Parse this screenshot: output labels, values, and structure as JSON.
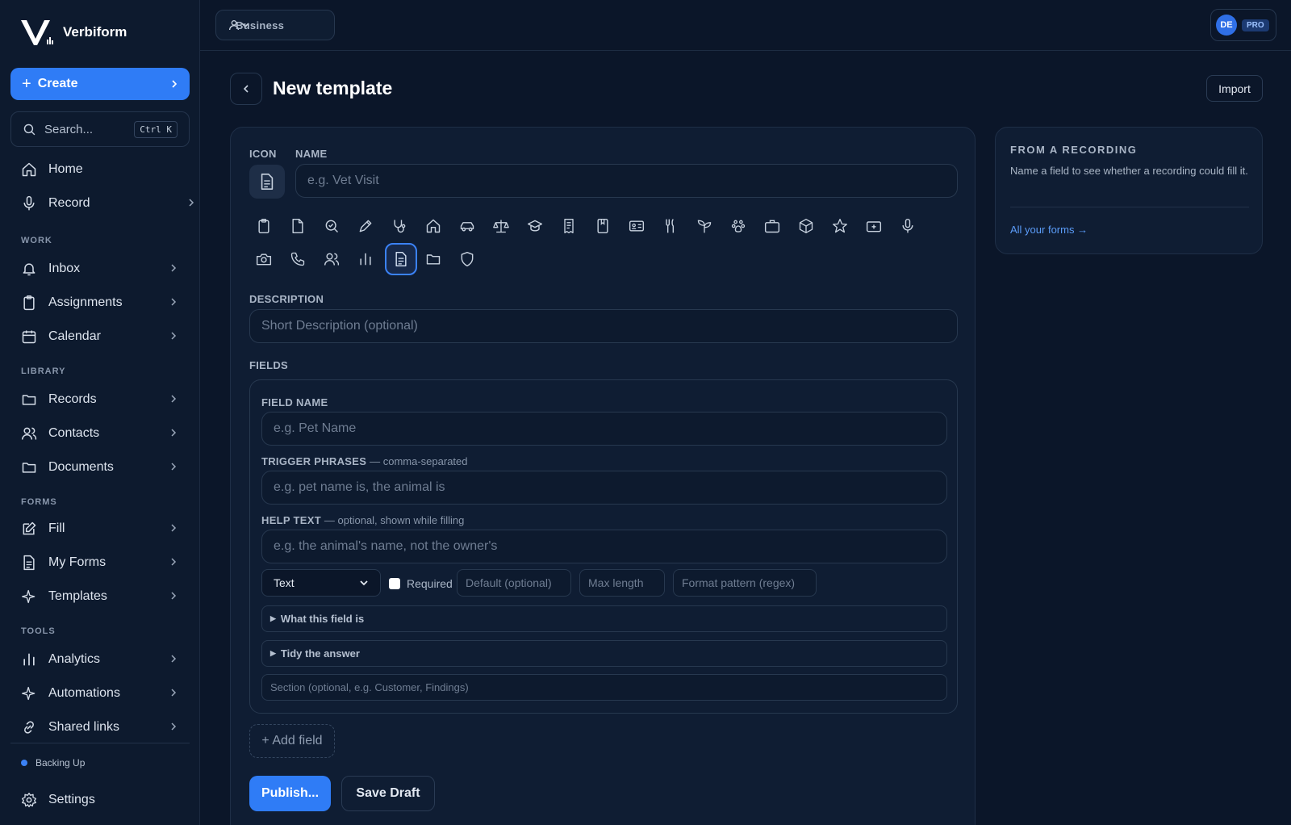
{
  "app": {
    "name": "Verbiform"
  },
  "sidebar": {
    "create_label": "Create",
    "search_placeholder": "Search...",
    "search_shortcut": "Ctrl K",
    "home": "Home",
    "record": "Record",
    "section_work": "WORK",
    "inbox": "Inbox",
    "assignments": "Assignments",
    "calendar": "Calendar",
    "section_library": "LIBRARY",
    "records": "Records",
    "contacts": "Contacts",
    "documents": "Documents",
    "section_forms": "FORMS",
    "fill": "Fill",
    "my_forms": "My Forms",
    "templates": "Templates",
    "section_tools": "TOOLS",
    "analytics": "Analytics",
    "automations": "Automations",
    "shared_links": "Shared links",
    "status": "Backing Up",
    "settings": "Settings"
  },
  "topbar": {
    "workspace": "Business",
    "user_initials": "DE",
    "plan_badge": "PRO"
  },
  "page": {
    "title": "New template",
    "import_label": "Import"
  },
  "form": {
    "icon_label": "ICON",
    "name_label": "NAME",
    "name_placeholder": "e.g. Vet Visit",
    "icon_options": [
      "clipboard",
      "file",
      "search",
      "pen",
      "stethoscope",
      "home",
      "car",
      "scale",
      "graduation-cap",
      "receipt",
      "bookmark",
      "id-card",
      "utensils",
      "sprout",
      "paw",
      "briefcase",
      "box",
      "star",
      "medical-case",
      "microphone",
      "camera",
      "phone",
      "users",
      "bar-chart",
      "document",
      "folder",
      "shield"
    ],
    "selected_icon": "document",
    "description_label": "DESCRIPTION",
    "description_placeholder": "Short Description (optional)",
    "fields_label": "FIELDS",
    "field": {
      "name_label": "FIELD NAME",
      "name_placeholder": "e.g. Pet Name",
      "trigger_label": "TRIGGER PHRASES",
      "trigger_hint": "— comma-separated",
      "trigger_placeholder": "e.g. pet name is, the animal is",
      "help_label": "HELP TEXT",
      "help_hint": "— optional, shown while filling",
      "help_placeholder": "e.g. the animal's name, not the owner's",
      "type_value": "Text",
      "required_label": "Required",
      "default_placeholder": "Default (optional)",
      "maxlength_placeholder": "Max length",
      "format_placeholder": "Format pattern (regex)",
      "what_label": "What this field is",
      "tidy_label": "Tidy the answer",
      "section_placeholder": "Section (optional, e.g. Customer, Findings)"
    },
    "add_field_label": "+ Add field",
    "publish_label": "Publish...",
    "save_draft_label": "Save Draft"
  },
  "recording_card": {
    "title": "FROM A RECORDING",
    "text": "Name a field to see whether a recording could fill it.",
    "link": "All your forms →"
  },
  "colors": {
    "background": "#0b1629",
    "accent": "#2f7cf6",
    "panel": "#0f1d33"
  }
}
